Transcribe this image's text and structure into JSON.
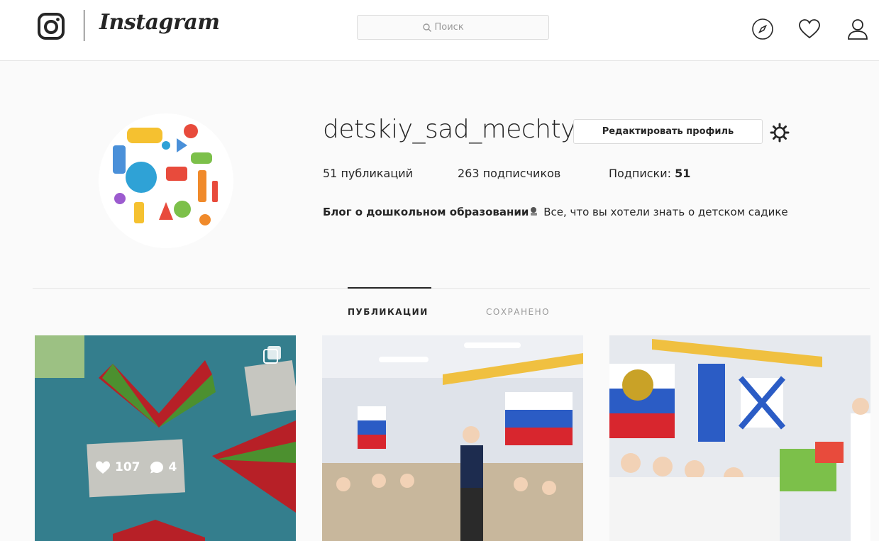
{
  "header": {
    "brand": "Instagram",
    "search_placeholder": "Поиск",
    "icons": [
      "instagram-logo-icon",
      "compass-icon",
      "heart-icon",
      "person-icon"
    ]
  },
  "profile": {
    "username": "detskiy_sad_mechty",
    "edit_button": "Редактировать профиль",
    "stats": {
      "posts": "51 публикаций",
      "followers": "263 подписчиков",
      "following_label": "Подписки: ",
      "following_count": "51"
    },
    "bio_name": "Блог о дошкольном образовании",
    "bio_text": " Все, что вы хотели знать о детском садике"
  },
  "tabs": {
    "posts": "ПУБЛИКАЦИИ",
    "saved": "СОХРАНЕНО"
  },
  "posts": [
    {
      "likes": "107",
      "comments": "4"
    },
    {},
    {}
  ],
  "colors": {
    "text": "#262626",
    "muted": "#999999",
    "border": "#dbdbdb",
    "background": "#fafafa"
  }
}
